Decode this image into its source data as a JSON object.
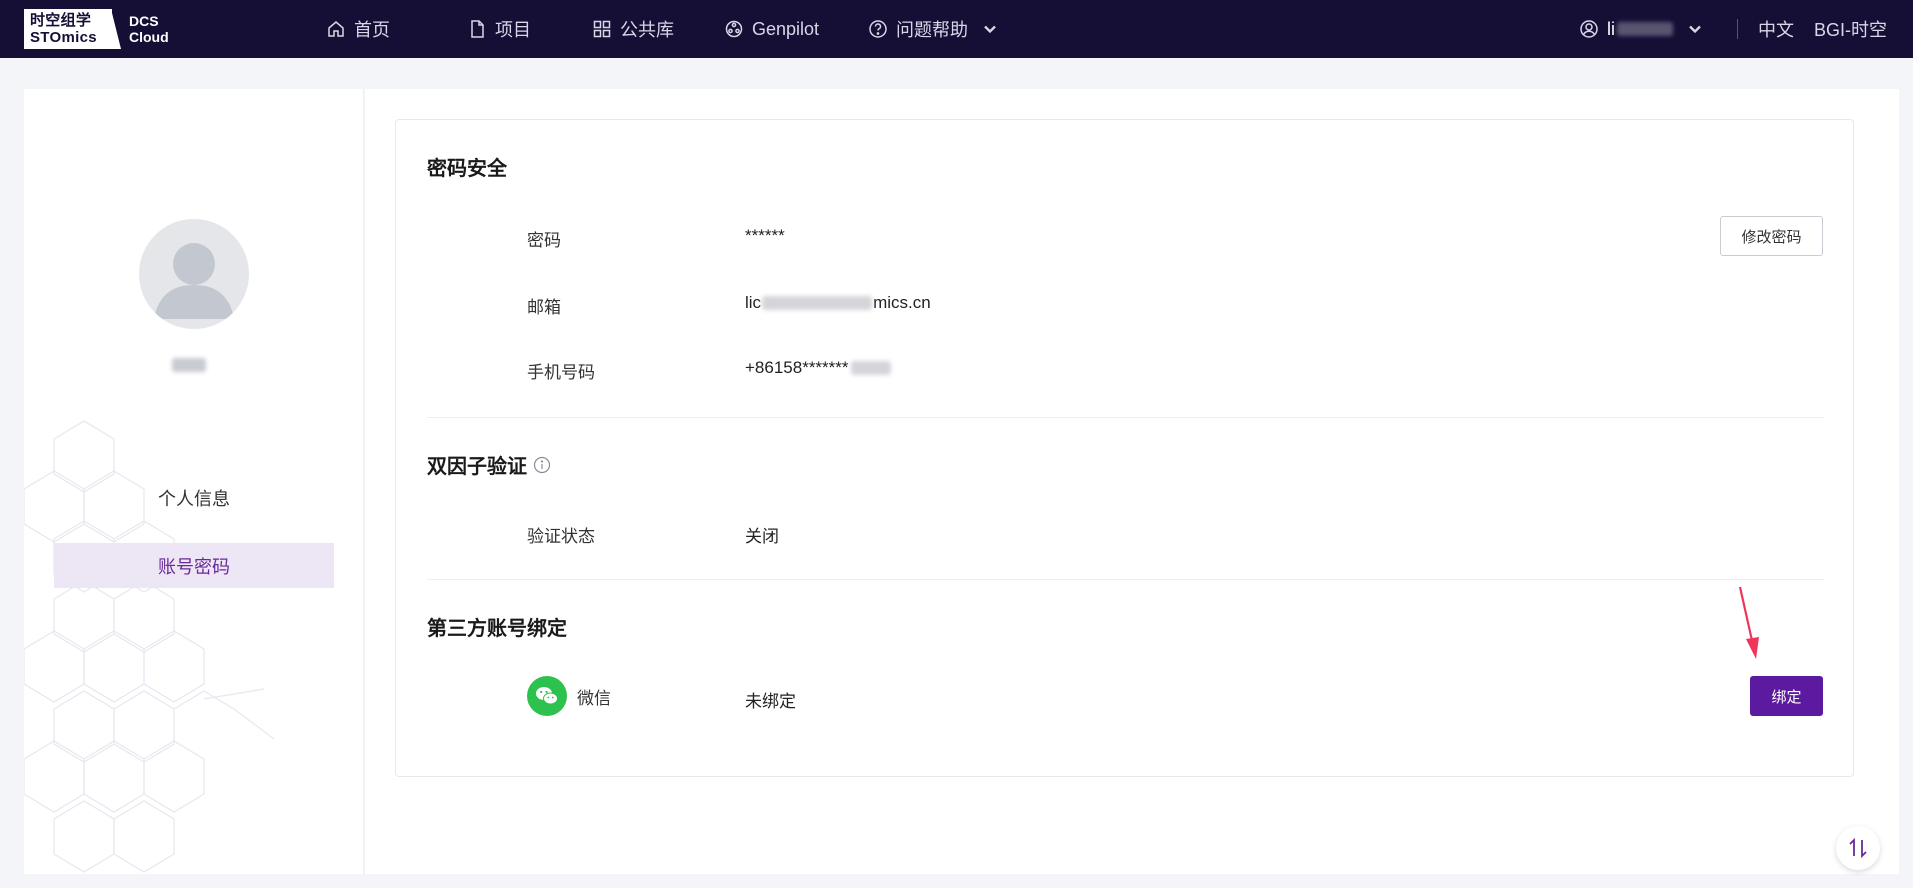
{
  "brand": {
    "logo_cn": "时空组学",
    "logo_en": "STOmics",
    "product_line1": "DCS",
    "product_line2": "Cloud"
  },
  "nav": {
    "items": [
      {
        "label": "首页",
        "icon": "home-icon"
      },
      {
        "label": "项目",
        "icon": "document-icon"
      },
      {
        "label": "公共库",
        "icon": "grid-icon"
      },
      {
        "label": "Genpilot",
        "icon": "genpilot-icon"
      },
      {
        "label": "问题帮助",
        "icon": "help-icon"
      }
    ],
    "user_prefix": "li",
    "language": "中文",
    "organization": "BGI-时空"
  },
  "sidebar": {
    "menu": [
      {
        "label": "个人信息",
        "active": false
      },
      {
        "label": "账号密码",
        "active": true
      }
    ]
  },
  "security": {
    "title": "密码安全",
    "rows": [
      {
        "label": "密码",
        "value": "******"
      },
      {
        "label": "邮箱",
        "value_prefix": "lic",
        "value_suffix": "mics.cn"
      },
      {
        "label": "手机号码",
        "value": "+86158*******"
      }
    ],
    "change_password_button": "修改密码"
  },
  "two_factor": {
    "title": "双因子验证",
    "status_label": "验证状态",
    "status_value": "关闭"
  },
  "third_party": {
    "title": "第三方账号绑定",
    "account_name": "微信",
    "status": "未绑定",
    "bind_button": "绑定"
  },
  "colors": {
    "topbar": "#150f36",
    "accent": "#5b1a9f",
    "active_menu_bg": "#ede6f4",
    "wechat": "#2dc14e",
    "annotation_arrow": "#f0345a"
  }
}
